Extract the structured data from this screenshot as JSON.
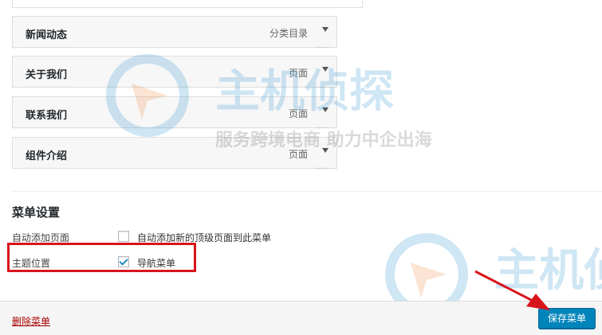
{
  "menu_items": [
    {
      "title": "新闻动态",
      "type": "分类目录"
    },
    {
      "title": "关于我们",
      "type": "页面"
    },
    {
      "title": "联系我们",
      "type": "页面"
    },
    {
      "title": "组件介绍",
      "type": "页面"
    }
  ],
  "menu_settings": {
    "title": "菜单设置",
    "auto_add_label": "自动添加页面",
    "auto_add_checkbox_label": "自动添加新的顶级页面到此菜单",
    "auto_add_checked": false,
    "theme_location_label": "主题位置",
    "theme_location_checkbox_label": "导航菜单",
    "theme_location_checked": true
  },
  "footer": {
    "delete_label": "删除菜单",
    "save_label": "保存菜单"
  },
  "watermark": {
    "brand": "主机侦探",
    "slogan": "服务跨境电商 助力中企出海"
  },
  "colors": {
    "primary_button": "#0085ba",
    "delete_link": "#aa0000",
    "annotation_red": "#d8141b",
    "watermark_blue": "#2a8fd0"
  }
}
